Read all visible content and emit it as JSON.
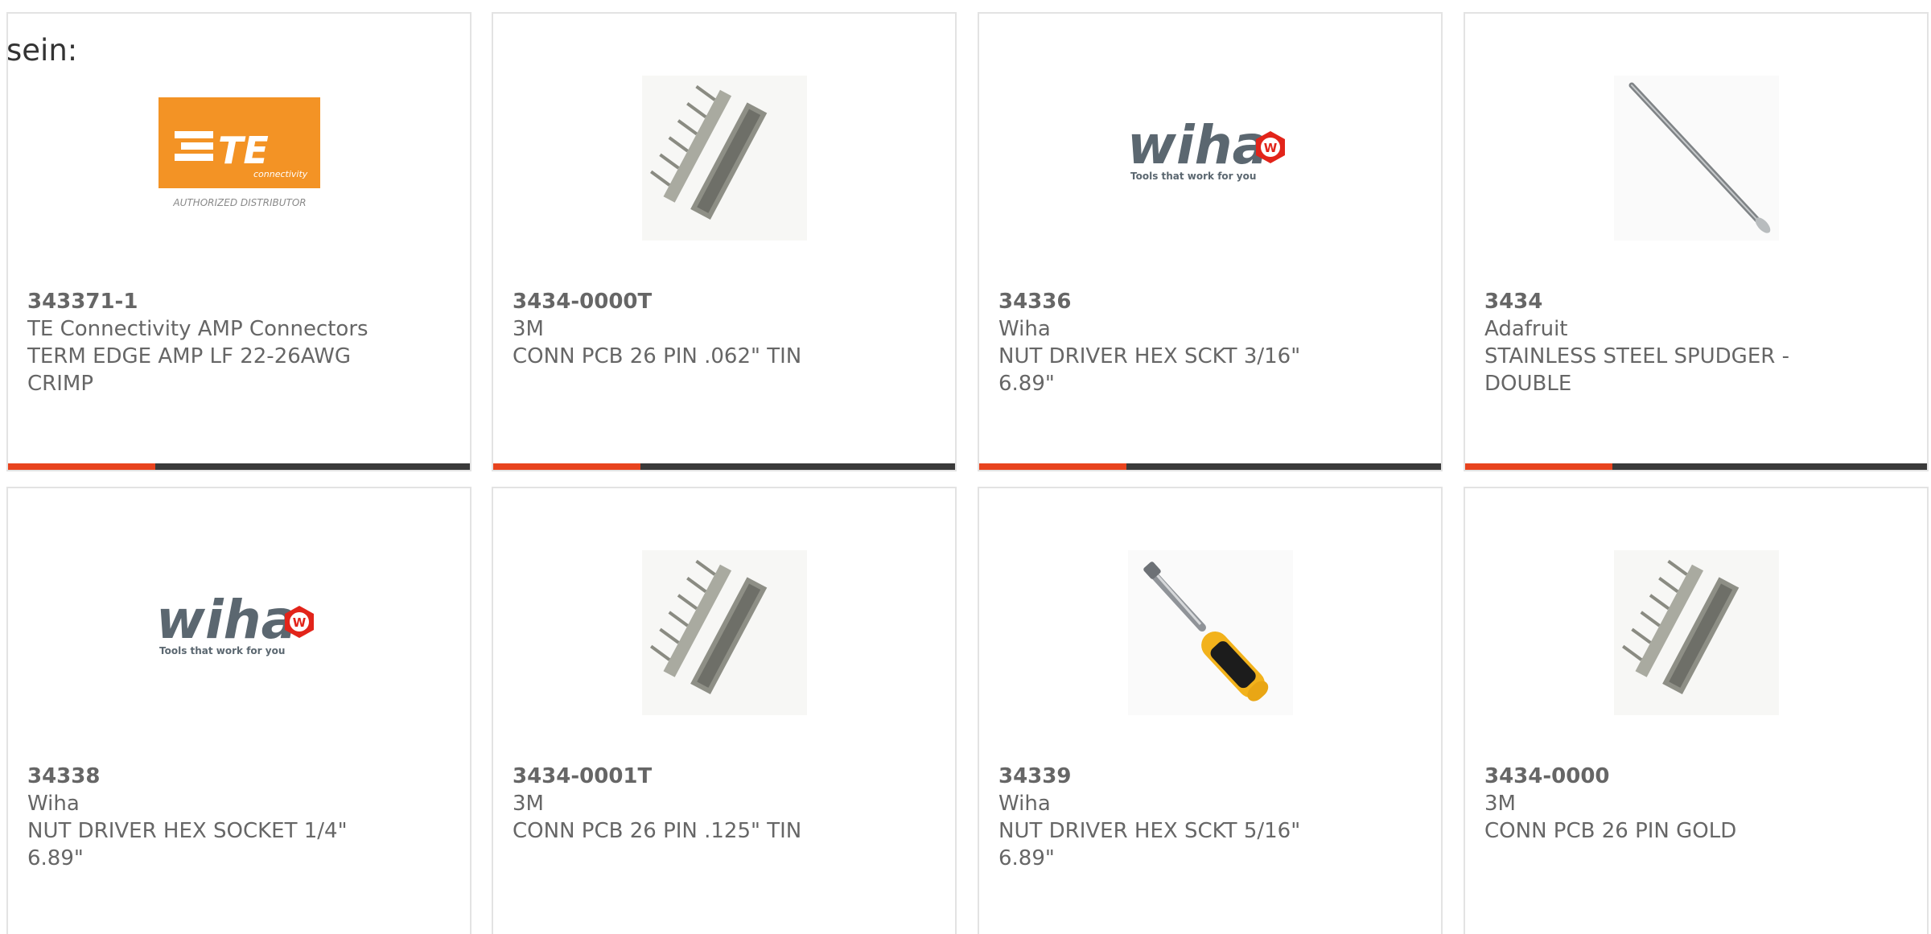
{
  "intro_text": "sein:",
  "colors": {
    "accent": "#e8431e",
    "bar": "#3a3a3a",
    "border": "#e3e3e3",
    "text": "#666666",
    "te_orange": "#f39325",
    "wiha_gray": "#5b6770",
    "wiha_red": "#e2241a"
  },
  "logos": {
    "te_main": "TE",
    "te_sub": "connectivity",
    "te_tag": "AUTHORIZED DISTRIBUTOR",
    "wiha_word": "wiha",
    "wiha_tagline": "Tools that work for you",
    "wiha_badge": "W"
  },
  "products": [
    {
      "part": "343371-1",
      "manufacturer": "TE Connectivity AMP Connectors",
      "description": "TERM EDGE AMP LF 22-26AWG CRIMP",
      "image": "te-connectivity-logo",
      "show_bar": true
    },
    {
      "part": "3434-0000T",
      "manufacturer": "3M",
      "description": "CONN PCB 26 PIN .062\" TIN",
      "image": "pcb-connector-photo",
      "show_bar": true
    },
    {
      "part": "34336",
      "manufacturer": "Wiha",
      "description": "NUT DRIVER HEX SCKT 3/16\" 6.89\"",
      "image": "wiha-logo",
      "show_bar": true
    },
    {
      "part": "3434",
      "manufacturer": "Adafruit",
      "description": "STAINLESS STEEL SPUDGER - DOUBLE",
      "image": "spudger-photo",
      "show_bar": true
    },
    {
      "part": "34338",
      "manufacturer": "Wiha",
      "description": "NUT DRIVER HEX SOCKET 1/4\" 6.89\"",
      "image": "wiha-logo",
      "show_bar": false
    },
    {
      "part": "3434-0001T",
      "manufacturer": "3M",
      "description": "CONN PCB 26 PIN .125\" TIN",
      "image": "pcb-connector-photo",
      "show_bar": false
    },
    {
      "part": "34339",
      "manufacturer": "Wiha",
      "description": "NUT DRIVER HEX SCKT 5/16\" 6.89\"",
      "image": "nut-driver-photo",
      "show_bar": false
    },
    {
      "part": "3434-0000",
      "manufacturer": "3M",
      "description": "CONN PCB 26 PIN GOLD",
      "image": "pcb-connector-photo",
      "show_bar": false
    }
  ]
}
